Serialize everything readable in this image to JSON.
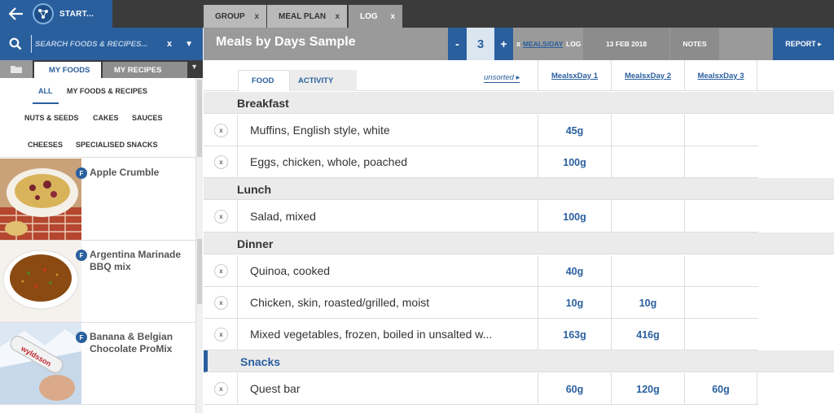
{
  "topbar": {
    "start_label": "START...",
    "tabs": [
      {
        "label": "GROUP",
        "close": "x"
      },
      {
        "label": "MEAL PLAN",
        "close": "x"
      },
      {
        "label": "LOG",
        "close": "x"
      }
    ]
  },
  "search": {
    "placeholder": "SEARCH FOODS & RECIPES...",
    "clear": "x",
    "dropdown": "▼"
  },
  "food_tabs": {
    "my_foods": "MY FOODS",
    "my_recipes": "MY RECIPES",
    "dropdown": "▼"
  },
  "categories": [
    "ALL",
    "MY FOODS & RECIPES",
    "NUTS & SEEDS",
    "CAKES",
    "SAUCES",
    "CHEESES",
    "SPECIALISED SNACKS"
  ],
  "food_list": [
    {
      "badge": "F",
      "name": "Apple Crumble"
    },
    {
      "badge": "F",
      "name": "Argentina Marinade BBQ mix"
    },
    {
      "badge": "F",
      "name": "Banana & Belgian Chocolate ProMix"
    }
  ],
  "header": {
    "title": "Meals by Days Sample",
    "minus": "-",
    "days": "3",
    "plus": "+",
    "x_label": "x",
    "meals_per_day": "MEALS/DAY",
    "log": "LOG",
    "date": "13 FEB 2018",
    "notes": "NOTES",
    "report": "REPORT ▸"
  },
  "subheader": {
    "food_tab": "FOOD",
    "activity_tab": "ACTIVITY",
    "sort": "unsorted ▸",
    "day_columns": [
      "MealsxDay 1",
      "MealsxDay 2",
      "MealsxDay 3"
    ]
  },
  "sections": [
    {
      "label": "Breakfast",
      "rows": [
        {
          "remove": "x",
          "name": "Muffins, English style, white",
          "values": [
            "45g",
            "",
            ""
          ]
        },
        {
          "remove": "x",
          "name": "Eggs, chicken, whole, poached",
          "values": [
            "100g",
            "",
            ""
          ]
        }
      ]
    },
    {
      "label": "Lunch",
      "rows": [
        {
          "remove": "x",
          "name": "Salad, mixed",
          "values": [
            "100g",
            "",
            ""
          ]
        }
      ]
    },
    {
      "label": "Dinner",
      "rows": [
        {
          "remove": "x",
          "name": "Quinoa, cooked",
          "values": [
            "40g",
            "",
            ""
          ]
        },
        {
          "remove": "x",
          "name": "Chicken, skin, roasted/grilled, moist",
          "values": [
            "10g",
            "10g",
            ""
          ]
        },
        {
          "remove": "x",
          "name": "Mixed vegetables, frozen, boiled in unsalted w...",
          "values": [
            "163g",
            "416g",
            ""
          ]
        }
      ]
    },
    {
      "label": "Snacks",
      "rows": [
        {
          "remove": "x",
          "name": "Quest bar",
          "values": [
            "60g",
            "120g",
            "60g"
          ]
        }
      ]
    }
  ],
  "colors": {
    "accent": "#2a5f9e",
    "topbar": "#3b3b3b",
    "header_grey": "#9a9a9a",
    "section_grey": "#ebebeb"
  }
}
